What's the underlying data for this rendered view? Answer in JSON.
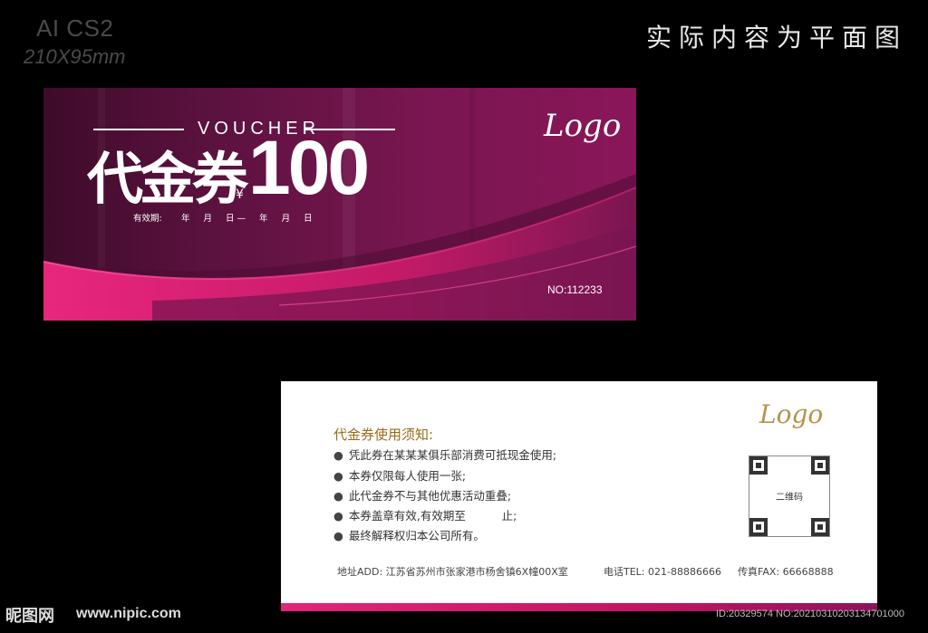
{
  "meta": {
    "format": "AI CS2",
    "size": "210X95mm",
    "headline": "实际内容为平面图"
  },
  "front": {
    "voucher_label": "VOUCHER",
    "title": "代金券",
    "currency": "¥",
    "amount": "100",
    "validity_label": "有效期:",
    "validity_fields": "年 月 日— 年 月 日",
    "logo": "Logo",
    "serial": "NO:112233"
  },
  "back": {
    "logo": "Logo",
    "notice_title": "代金券使用须知:",
    "rules": [
      "凭此券在某某某俱乐部消费可抵现金使用;",
      "本券仅限每人使用一张;",
      "此代金券不与其他优惠活动重叠;",
      "本券盖章有效,有效期至          止;",
      "最终解释权归本公司所有。"
    ],
    "qr_label": "二维码",
    "address": "地址ADD: 江苏省苏州市张家港市杨舍镇6X幢00X室",
    "phone": "电话TEL: 021-88886666",
    "fax": "传真FAX: 66668888"
  },
  "watermark": {
    "brand": "昵图网",
    "url": "www.nipic.com",
    "id": "ID:20329574 NO:20210310203134701000"
  },
  "colors": {
    "accent": "#e0267a",
    "card_dark": "#5d1240",
    "gold": "#b8924c"
  }
}
